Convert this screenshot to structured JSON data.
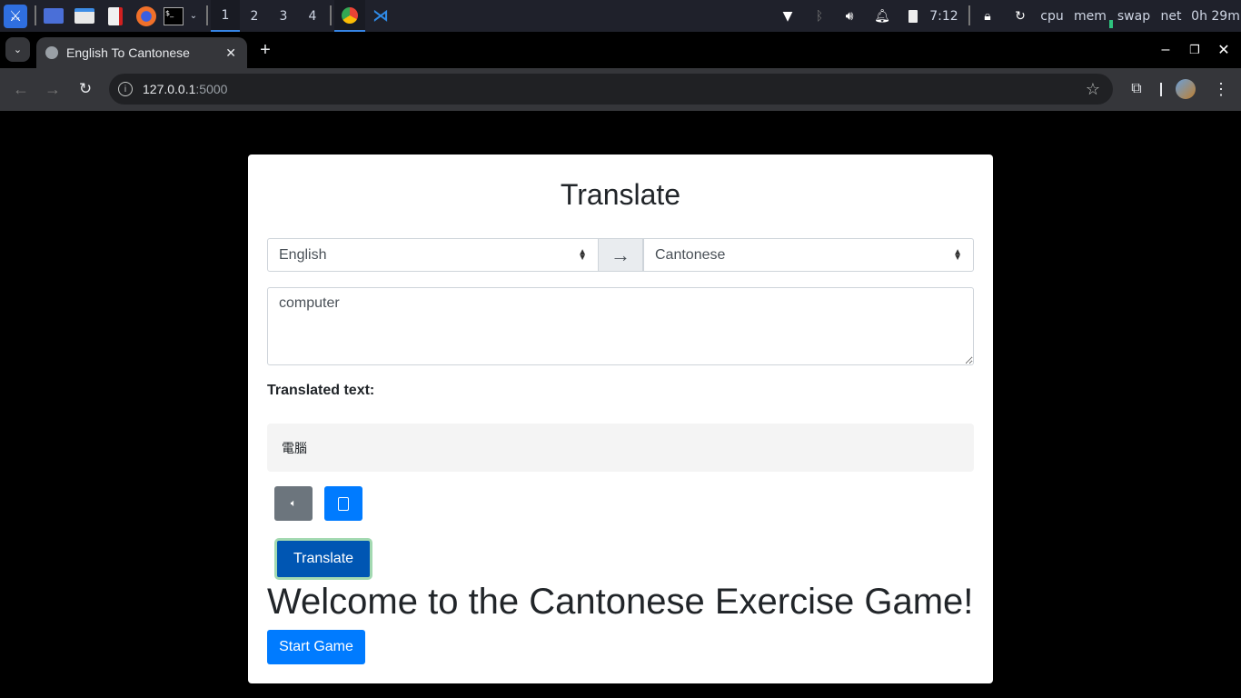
{
  "taskbar": {
    "workspaces": [
      "1",
      "2",
      "3",
      "4"
    ],
    "clock": "7:12",
    "monitors": [
      "cpu",
      "mem",
      "swap",
      "net"
    ],
    "uptime": "0h 29m"
  },
  "browser": {
    "tab_title": "English To Cantonese",
    "url_host": "127.0.0.1",
    "url_port": ":5000"
  },
  "page": {
    "title": "Translate",
    "source_language": "English",
    "target_language": "Cantonese",
    "input_text": "computer",
    "translated_label": "Translated text:",
    "translated_text": "電腦",
    "translate_button": "Translate",
    "game_heading": "Welcome to the Cantonese Exercise Game!",
    "start_button": "Start Game"
  },
  "colors": {
    "primary": "#007bff",
    "secondary": "#6c757d",
    "translate_active": "#0056b3"
  }
}
